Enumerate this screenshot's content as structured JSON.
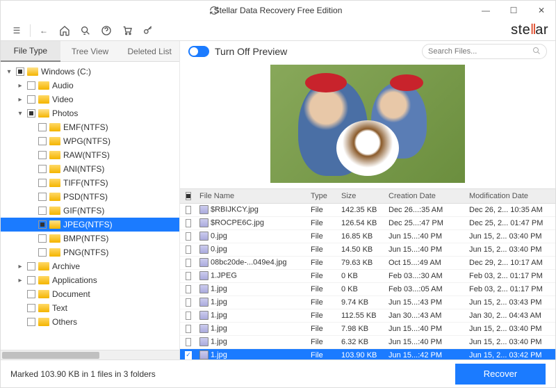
{
  "window": {
    "title": "Stellar Data Recovery Free Edition"
  },
  "brand": {
    "pre": "ste",
    "mid": "ll",
    "post": "ar"
  },
  "tabs": {
    "file_type": "File Type",
    "tree_view": "Tree View",
    "deleted_list": "Deleted List"
  },
  "tree": [
    {
      "depth": 0,
      "expander": "▾",
      "check": "partial",
      "icon": "open",
      "label": "Windows (C:)"
    },
    {
      "depth": 1,
      "expander": "▸",
      "check": "",
      "icon": "closed",
      "label": "Audio"
    },
    {
      "depth": 1,
      "expander": "▸",
      "check": "",
      "icon": "closed",
      "label": "Video"
    },
    {
      "depth": 1,
      "expander": "▾",
      "check": "partial",
      "icon": "open",
      "label": "Photos"
    },
    {
      "depth": 2,
      "expander": "",
      "check": "",
      "icon": "closed",
      "label": "EMF(NTFS)"
    },
    {
      "depth": 2,
      "expander": "",
      "check": "",
      "icon": "closed",
      "label": "WPG(NTFS)"
    },
    {
      "depth": 2,
      "expander": "",
      "check": "",
      "icon": "closed",
      "label": "RAW(NTFS)"
    },
    {
      "depth": 2,
      "expander": "",
      "check": "",
      "icon": "closed",
      "label": "ANI(NTFS)"
    },
    {
      "depth": 2,
      "expander": "",
      "check": "",
      "icon": "closed",
      "label": "TIFF(NTFS)"
    },
    {
      "depth": 2,
      "expander": "",
      "check": "",
      "icon": "closed",
      "label": "PSD(NTFS)"
    },
    {
      "depth": 2,
      "expander": "",
      "check": "",
      "icon": "closed",
      "label": "GIF(NTFS)"
    },
    {
      "depth": 2,
      "expander": "",
      "check": "partial",
      "icon": "open",
      "label": "JPEG(NTFS)",
      "selected": true
    },
    {
      "depth": 2,
      "expander": "",
      "check": "",
      "icon": "closed",
      "label": "BMP(NTFS)"
    },
    {
      "depth": 2,
      "expander": "",
      "check": "",
      "icon": "closed",
      "label": "PNG(NTFS)"
    },
    {
      "depth": 1,
      "expander": "▸",
      "check": "",
      "icon": "closed",
      "label": "Archive"
    },
    {
      "depth": 1,
      "expander": "▸",
      "check": "",
      "icon": "closed",
      "label": "Applications"
    },
    {
      "depth": 1,
      "expander": "",
      "check": "",
      "icon": "closed",
      "label": "Document"
    },
    {
      "depth": 1,
      "expander": "",
      "check": "",
      "icon": "closed",
      "label": "Text"
    },
    {
      "depth": 1,
      "expander": "",
      "check": "",
      "icon": "closed",
      "label": "Others"
    }
  ],
  "preview": {
    "toggle_label": "Turn Off Preview",
    "search_placeholder": "Search Files..."
  },
  "table": {
    "headers": {
      "name": "File Name",
      "type": "Type",
      "size": "Size",
      "cdate": "Creation Date",
      "mdate": "Modification Date"
    },
    "rows": [
      {
        "chk": false,
        "name": "$RBIJKCY.jpg",
        "type": "File",
        "size": "142.35 KB",
        "cdate": "Dec 26...:35 AM",
        "mdate": "Dec 26, 2... 10:35 AM"
      },
      {
        "chk": false,
        "name": "$ROCPE6C.jpg",
        "type": "File",
        "size": "126.54 KB",
        "cdate": "Dec 25...:47 PM",
        "mdate": "Dec 25, 2... 01:47 PM"
      },
      {
        "chk": false,
        "name": "0.jpg",
        "type": "File",
        "size": "16.85 KB",
        "cdate": "Jun 15...:40 PM",
        "mdate": "Jun 15, 2... 03:40 PM"
      },
      {
        "chk": false,
        "name": "0.jpg",
        "type": "File",
        "size": "14.50 KB",
        "cdate": "Jun 15...:40 PM",
        "mdate": "Jun 15, 2... 03:40 PM"
      },
      {
        "chk": false,
        "name": "08bc20de-...049e4.jpg",
        "type": "File",
        "size": "79.63 KB",
        "cdate": "Oct 15...:49 AM",
        "mdate": "Dec 29, 2... 10:17 AM"
      },
      {
        "chk": false,
        "name": "1.JPEG",
        "type": "File",
        "size": "0 KB",
        "cdate": "Feb 03...:30 AM",
        "mdate": "Feb 03, 2... 01:17 PM"
      },
      {
        "chk": false,
        "name": "1.jpg",
        "type": "File",
        "size": "0 KB",
        "cdate": "Feb 03...:05 AM",
        "mdate": "Feb 03, 2... 01:17 PM"
      },
      {
        "chk": false,
        "name": "1.jpg",
        "type": "File",
        "size": "9.74 KB",
        "cdate": "Jun 15...:43 PM",
        "mdate": "Jun 15, 2... 03:43 PM"
      },
      {
        "chk": false,
        "name": "1.jpg",
        "type": "File",
        "size": "112.55 KB",
        "cdate": "Jan 30...:43 AM",
        "mdate": "Jan 30, 2... 04:43 AM"
      },
      {
        "chk": false,
        "name": "1.jpg",
        "type": "File",
        "size": "7.98 KB",
        "cdate": "Jun 15...:40 PM",
        "mdate": "Jun 15, 2... 03:40 PM"
      },
      {
        "chk": false,
        "name": "1.jpg",
        "type": "File",
        "size": "6.32 KB",
        "cdate": "Jun 15...:40 PM",
        "mdate": "Jun 15, 2... 03:40 PM"
      },
      {
        "chk": true,
        "name": "1.jpg",
        "type": "File",
        "size": "103.90 KB",
        "cdate": "Jun 15...:42 PM",
        "mdate": "Jun 15, 2... 03:42 PM",
        "selected": true
      }
    ]
  },
  "footer": {
    "status": "Marked 103.90 KB in 1 files in 3 folders",
    "recover": "Recover"
  }
}
